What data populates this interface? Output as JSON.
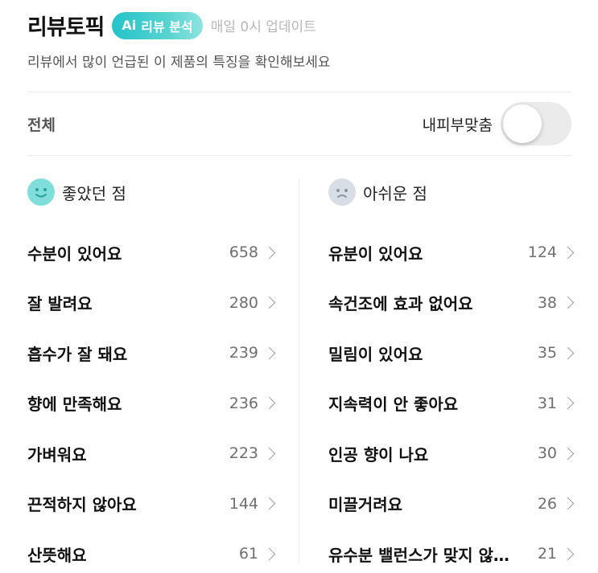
{
  "header": {
    "title": "리뷰토픽",
    "ai_badge": {
      "ai": "Ai",
      "label": "리뷰 분석"
    },
    "update_note": "매일 0시 업데이트",
    "subtitle": "리뷰에서 많이 언급된 이 제품의 특징을 확인해보세요"
  },
  "filter": {
    "all_label": "전체",
    "skin_match_label": "내피부맞춤",
    "skin_match_on": false
  },
  "good": {
    "title": "좋았던 점",
    "icon": "smile-face-icon",
    "items": [
      {
        "label": "수분이 있어요",
        "count": "658"
      },
      {
        "label": "잘 발려요",
        "count": "280"
      },
      {
        "label": "흡수가 잘 돼요",
        "count": "239"
      },
      {
        "label": "향에 만족해요",
        "count": "236"
      },
      {
        "label": "가벼워요",
        "count": "223"
      },
      {
        "label": "끈적하지 않아요",
        "count": "144"
      },
      {
        "label": "산뜻해요",
        "count": "61"
      }
    ]
  },
  "bad": {
    "title": "아쉬운 점",
    "icon": "sad-face-icon",
    "items": [
      {
        "label": "유분이 있어요",
        "count": "124"
      },
      {
        "label": "속건조에 효과 없어요",
        "count": "38"
      },
      {
        "label": "밀림이 있어요",
        "count": "35"
      },
      {
        "label": "지속력이 안 좋아요",
        "count": "31"
      },
      {
        "label": "인공 향이 나요",
        "count": "30"
      },
      {
        "label": "미끌거려요",
        "count": "26"
      },
      {
        "label": "유수분 밸런스가 맞지 않…",
        "count": "21"
      }
    ]
  },
  "colors": {
    "accent": "#22c3c9",
    "good_face": "#7fded9",
    "bad_face": "#d9dee6"
  }
}
